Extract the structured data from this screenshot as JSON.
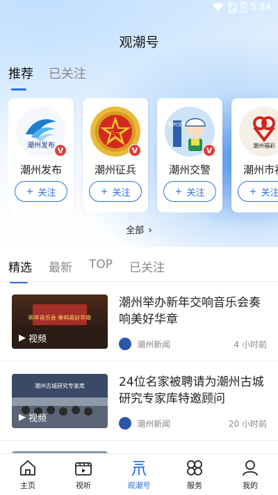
{
  "status": {
    "time": "5:34"
  },
  "header": {
    "title": "观潮号"
  },
  "top_tabs": [
    {
      "label": "推荐",
      "active": true
    },
    {
      "label": "已关注",
      "active": false
    }
  ],
  "accounts": [
    {
      "name": "潮州发布",
      "follow_label": "关注",
      "logo": "chaozhou-release-logo",
      "logo_text": "潮州发布"
    },
    {
      "name": "潮州征兵",
      "follow_label": "关注",
      "logo": "army-emblem-logo",
      "logo_text": "八一"
    },
    {
      "name": "潮州交警",
      "follow_label": "关注",
      "logo": "traffic-police-logo",
      "logo_text": "潮州交警"
    },
    {
      "name": "潮州市福",
      "follow_label": "关注",
      "logo": "welfare-lottery-logo",
      "logo_text": "潮州福彩"
    }
  ],
  "verified_badge": "V",
  "all_link": "全部",
  "feed_tabs": [
    {
      "label": "精选",
      "active": true
    },
    {
      "label": "最新",
      "active": false
    },
    {
      "label": "TOP",
      "active": false
    },
    {
      "label": "已关注",
      "active": false
    }
  ],
  "news": [
    {
      "title": "潮州举办新年交响音乐会奏响美好华章",
      "tag": "视频",
      "source": "潮州新闻",
      "time": "4 小时前",
      "thumb_text": "新年音乐会 奏响美好华章"
    },
    {
      "title": "24位名家被聘请为潮州古城研究专家库特邀顾问",
      "tag": "视频",
      "source": "潮州新闻",
      "time": "20 小时前",
      "thumb_text": "潮州古城研究专家库"
    }
  ],
  "bottom_nav": [
    {
      "label": "主页",
      "icon": "home-icon",
      "active": false
    },
    {
      "label": "视听",
      "icon": "video-icon",
      "active": false
    },
    {
      "label": "观潮号",
      "icon": "guanchao-icon",
      "active": true
    },
    {
      "label": "服务",
      "icon": "service-icon",
      "active": false
    },
    {
      "label": "我的",
      "icon": "profile-icon",
      "active": false
    }
  ],
  "colors": {
    "accent": "#2a6fdc",
    "badge_red": "#e23b3b"
  }
}
